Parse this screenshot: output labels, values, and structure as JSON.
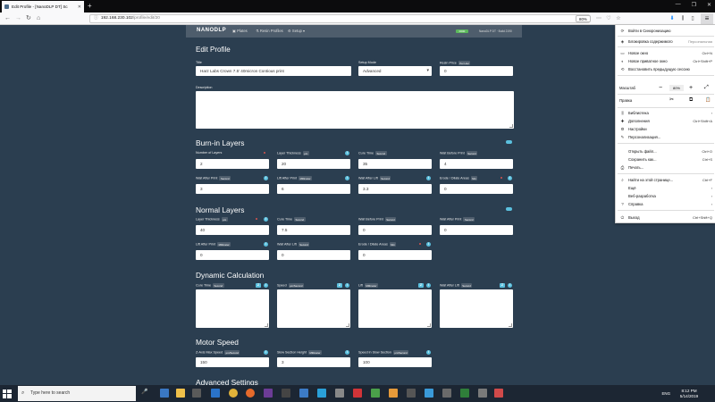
{
  "browser": {
    "tab_title": "Edit Profile - [NanoDLP DT] Sc",
    "tab_close": "✕",
    "new_tab": "+",
    "url_host": "192.168.230.102",
    "url_path": "/profile/edit/20",
    "zoom_badge": "80%",
    "window_controls": [
      "—",
      "❐",
      "✕"
    ]
  },
  "app": {
    "logo": "NANODLP",
    "nav": [
      "Plates",
      "Resin Profiles",
      "Setup ▾"
    ],
    "version_badge": "0000",
    "name": "NanoDLP DT · Build 2190"
  },
  "page": {
    "title": "Edit Profile",
    "fields": {
      "title_label": "Title",
      "title_value": "Harz Labs Crown 7.5' 40micron  Contious print",
      "setup_mode_label": "Setup Mode",
      "setup_mode_value": "Advanced",
      "resin_price_label": "Resin Price",
      "resin_price_badge": "Per Liter",
      "resin_price_value": "0",
      "description_label": "Description"
    },
    "burnin": {
      "heading": "Burn-in Layers",
      "number_of_layers_label": "Number of Layers",
      "number_of_layers_value": "2",
      "layer_thickness_label": "Layer Thickness",
      "layer_thickness_badge": "µm",
      "layer_thickness_value": "20",
      "cure_time_label": "Cure Time",
      "cure_time_badge": "Second",
      "cure_time_value": "35",
      "wait_before_print_label": "Wait Before Print",
      "wait_before_print_badge": "Second",
      "wait_before_print_value": "4",
      "wait_after_print_label": "Wait After Print",
      "wait_after_print_badge": "Second",
      "wait_after_print_value": "3",
      "lift_after_print_label": "Lift After Print",
      "lift_after_print_badge": "Millimeter",
      "lift_after_print_value": "6",
      "wait_after_lift_label": "Wait After Lift",
      "wait_after_lift_badge": "Second",
      "wait_after_lift_value": "3.3",
      "erode_label": "Erode / Dilate Areas",
      "erode_badge": "Mm",
      "erode_value": "0"
    },
    "normal": {
      "heading": "Normal Layers",
      "layer_thickness_label": "Layer Thickness",
      "layer_thickness_badge": "µm",
      "layer_thickness_value": "40",
      "cure_time_label": "Cure Time",
      "cure_time_badge": "Second",
      "cure_time_value": "7.5",
      "wait_before_print_label": "Wait Before Print",
      "wait_before_print_badge": "Second",
      "wait_before_print_value": "0",
      "wait_after_print_label": "Wait After Print",
      "wait_after_print_badge": "Second",
      "wait_after_print_value": "0",
      "lift_after_print_label": "Lift After Print",
      "lift_after_print_badge": "Millimeter",
      "lift_after_print_value": "0",
      "wait_after_lift_label": "Wait After Lift",
      "wait_after_lift_badge": "Second",
      "wait_after_lift_value": "0",
      "erode_label": "Erode / Dilate Areas",
      "erode_badge": "Mm",
      "erode_value": "0"
    },
    "dynamic": {
      "heading": "Dynamic Calculation",
      "cure_time_label": "Cure Time",
      "cure_time_badge": "Second",
      "speed_label": "Speed",
      "speed_badge": "µm/Second",
      "lift_label": "Lift",
      "lift_badge": "Millimeter",
      "wait_after_lift_label": "Wait After Lift",
      "wait_after_lift_badge": "Second",
      "z_button": "Z"
    },
    "motor": {
      "heading": "Motor Speed",
      "z_axis_label": "Z-Axis Max Speed",
      "z_axis_badge": "µm/Second",
      "z_axis_value": "150",
      "slow_height_label": "Slow Section Height",
      "slow_height_badge": "Millimeter",
      "slow_height_value": "3",
      "slow_speed_label": "Speed in Slow Section",
      "slow_speed_badge": "µm/Second",
      "slow_speed_value": "100"
    },
    "advanced": {
      "heading": "Advanced Settings"
    },
    "info_glyph": "i"
  },
  "menu": {
    "sync": "Войти в Синхронизацию",
    "content_block": "Блокировка содержимого",
    "content_block_value": "Персональная",
    "new_window": "Новое окно",
    "new_window_sc": "Ctrl+N",
    "private_window": "Новое приватное окно",
    "private_window_sc": "Ctrl+Shift+P",
    "restore": "Восстановить предыдущую сессию",
    "zoom_label": "Масштаб",
    "zoom_minus": "−",
    "zoom_value": "80%",
    "zoom_plus": "+",
    "zoom_full": "⤢",
    "edit_label": "Правка",
    "edit_cut": "✂",
    "edit_copy": "⧉",
    "edit_paste": "📋",
    "library": "Библиотека",
    "addons": "Дополнения",
    "addons_sc": "Ctrl+Shift+A",
    "settings": "Настройки",
    "customize": "Персонализация...",
    "open_file": "Открыть файл...",
    "open_file_sc": "Ctrl+O",
    "save_as": "Сохранить как...",
    "save_as_sc": "Ctrl+S",
    "print": "Печать...",
    "find": "Найти на этой странице...",
    "find_sc": "Ctrl+F",
    "more": "Ещё",
    "webdev": "Веб-разработка",
    "help": "Справка",
    "quit": "Выход",
    "quit_sc": "Ctrl+Shift+Q",
    "chevron": "›"
  },
  "taskbar": {
    "search_placeholder": "Type here to search",
    "lang": "ENG",
    "time": "8:12 PM",
    "date": "5/14/2019"
  }
}
